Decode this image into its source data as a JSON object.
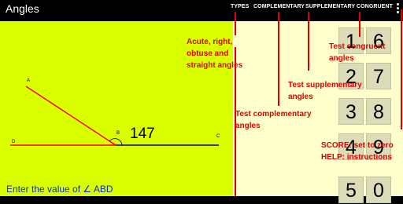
{
  "app_title": "Angles",
  "menu": {
    "types": "TYPES",
    "complementary": "COMPLEMENTARY",
    "supplementary": "SUPPLEMENTARY",
    "congruent": "CONGRUENT"
  },
  "canvas": {
    "angle_value": "147",
    "points": {
      "a": "A",
      "b": "B",
      "c": "C",
      "d": "D"
    },
    "prompt": "Enter the value of ∠ ABD"
  },
  "keypad": {
    "left_column": [
      "1",
      "2",
      "3",
      "4",
      "5"
    ],
    "right_column": [
      "6",
      "7",
      "8",
      "9",
      "0"
    ]
  },
  "help_overlay": {
    "types_lines": [
      "Acute, right,",
      "obtuse and",
      "straight angles"
    ],
    "complementary_lines": [
      "Test complementary",
      "angles"
    ],
    "supplementary_lines": [
      "Test supplementary",
      "angles"
    ],
    "congruent_lines": [
      "Test congruent",
      "angles"
    ],
    "score_lines": [
      "SCORE: set to zero",
      "HELP: instructions"
    ]
  },
  "colors": {
    "canvas_bg": "#d9ff00",
    "panel_bg": "#ffffcc",
    "ray_red": "#ff0000",
    "ray_blue": "#0000cc",
    "help_red": "#e00000",
    "prompt_blue": "#0b2fd0"
  }
}
